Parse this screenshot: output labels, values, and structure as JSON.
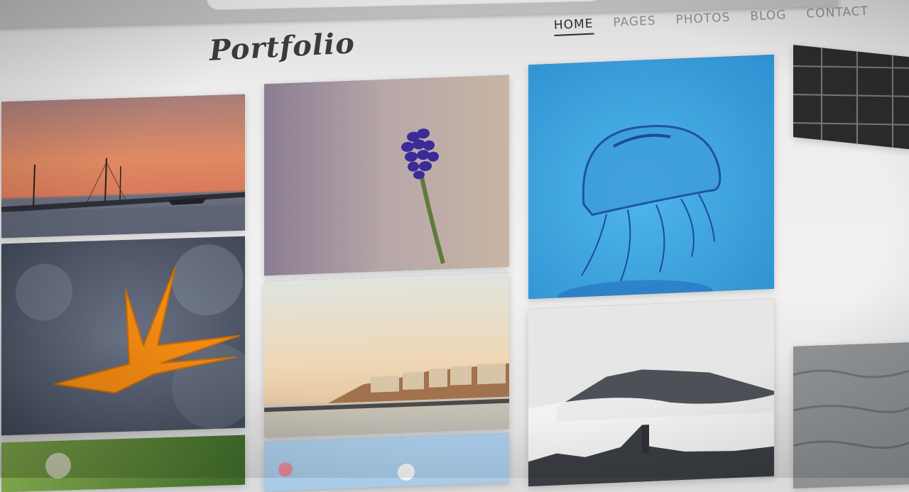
{
  "site": {
    "logo_text": "Portfolio"
  },
  "nav": {
    "items": [
      {
        "label": "HOME",
        "active": true
      },
      {
        "label": "PAGES",
        "active": false
      },
      {
        "label": "PHOTOS",
        "active": false
      },
      {
        "label": "BLOG",
        "active": false
      },
      {
        "label": "CONTACT",
        "active": false
      }
    ]
  },
  "gallery": {
    "tiles": [
      {
        "subject": "sailboats-sunset-photo"
      },
      {
        "subject": "grape-hyacinth-flower-photo"
      },
      {
        "subject": "jellyfish-photo"
      },
      {
        "subject": "orange-starfish-photo"
      },
      {
        "subject": "coastal-town-photo"
      },
      {
        "subject": "misty-mountain-village-photo"
      },
      {
        "subject": "green-foliage-photo"
      },
      {
        "subject": "sky-flowers-photo"
      },
      {
        "subject": "black-white-structure-photo"
      },
      {
        "subject": "black-white-water-photo"
      }
    ]
  },
  "colors": {
    "nav_active": "#2b2b2b",
    "nav_inactive": "#8a8a8a",
    "logo": "#3b3b3b",
    "page_bg": "#f1f1f1"
  }
}
